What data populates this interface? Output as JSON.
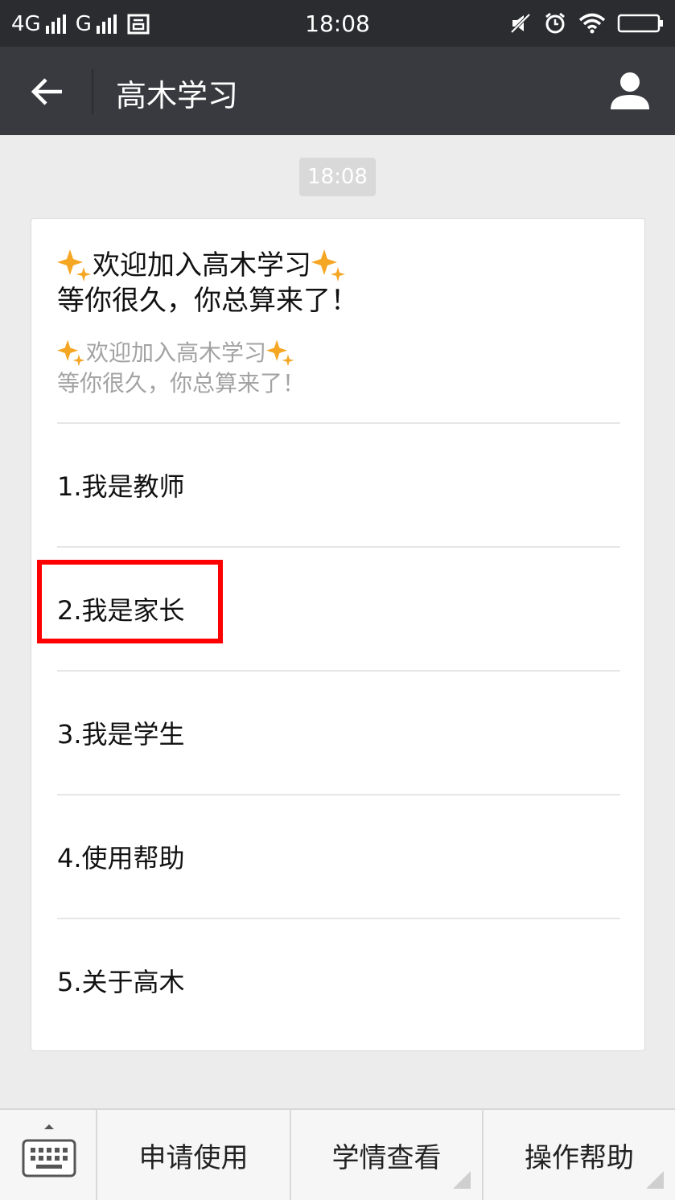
{
  "status_bar": {
    "network_1": "4G",
    "network_2": "G",
    "time": "18:08"
  },
  "title_bar": {
    "title": "高木学习"
  },
  "chat": {
    "timestamp": "18:08",
    "welcome": {
      "line1": "欢迎加入高木学习",
      "line2": "等你很久，你总算来了！",
      "sub_line1": "欢迎加入高木学习",
      "sub_line2": "等你很久，你总算来了！"
    },
    "menu_items": [
      {
        "label": "1.我是教师"
      },
      {
        "label": "2.我是家长"
      },
      {
        "label": "3.我是学生"
      },
      {
        "label": "4.使用帮助"
      },
      {
        "label": "5.关于高木"
      }
    ]
  },
  "bottom_menu": {
    "items": [
      {
        "label": "申请使用"
      },
      {
        "label": "学情查看"
      },
      {
        "label": "操作帮助"
      }
    ]
  },
  "colors": {
    "status_bar_bg": "#2b2c30",
    "title_bar_bg": "#393a3f",
    "chat_bg": "#ececec",
    "sparkle": "#f5a623",
    "highlight": "#ff0000"
  }
}
